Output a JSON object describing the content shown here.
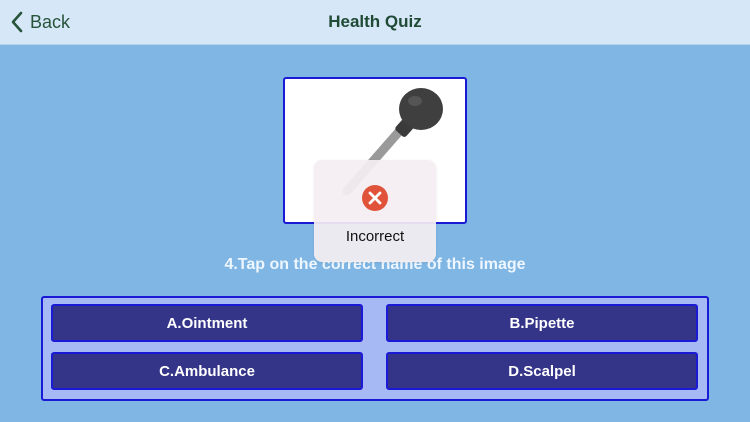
{
  "nav": {
    "back_label": "Back",
    "title": "Health Quiz"
  },
  "quiz": {
    "image_icon": "pipette-icon",
    "question": "4.Tap on the correct name of this image",
    "answers": [
      {
        "label": "A.Ointment"
      },
      {
        "label": "B.Pipette"
      },
      {
        "label": "C.Ambulance"
      },
      {
        "label": "D.Scalpel"
      }
    ]
  },
  "feedback": {
    "icon": "error-x-icon",
    "text": "Incorrect",
    "color": "#e0533a"
  },
  "colors": {
    "background": "#7fb6e4",
    "navbar": "#d6e8f7",
    "button": "#343489",
    "border": "#1a1ad6",
    "panel": "#a7b9f4"
  }
}
